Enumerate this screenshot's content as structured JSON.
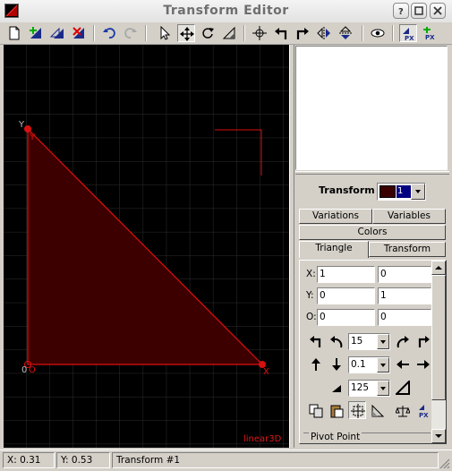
{
  "window": {
    "title": "Transform Editor"
  },
  "toolbar": {
    "tools": [
      "new-transform",
      "add-transform",
      "duplicate-transform",
      "delete-transform",
      "undo",
      "redo",
      "select-mode",
      "move-mode",
      "rotate-mode",
      "scale-mode",
      "reset-position",
      "rotate-left",
      "rotate-right",
      "flip-horizontal",
      "flip-vertical",
      "toggle-view",
      "post-transform",
      "pre-transform"
    ]
  },
  "canvas": {
    "vertex_y_label": "Y",
    "vertex_o_label": "O",
    "vertex_x_label": "X",
    "origin_value": "0",
    "mode_label": "linear3D",
    "colors": {
      "triangle_fill": "#3d0000",
      "triangle_edge": "#e01010",
      "grid": "#2e2e2e"
    }
  },
  "panel": {
    "transform_label": "Transform",
    "transform_selected": "1",
    "tabs_row1": [
      "Variations",
      "Variables"
    ],
    "tabs_row2": [
      "Colors"
    ],
    "tabs_row3": [
      "Triangle",
      "Transform"
    ],
    "active_tab": "Triangle",
    "coords": [
      {
        "label": "X:",
        "a": "1",
        "b": "0"
      },
      {
        "label": "Y:",
        "a": "0",
        "b": "1"
      },
      {
        "label": "O:",
        "a": "0",
        "b": "0"
      }
    ],
    "rotate_value": "15",
    "move_value": "0.1",
    "scale_value": "125",
    "pivot_label": "Pivot Point"
  },
  "status": {
    "x": "X: 0.31",
    "y": "Y: 0.53",
    "transform": "Transform #1"
  }
}
